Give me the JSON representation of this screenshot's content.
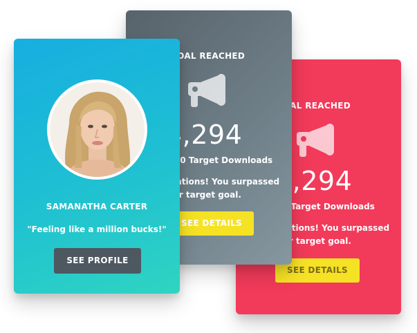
{
  "colors": {
    "red_card": "#f23a5a",
    "gray_card": "#6e7e87",
    "profile_card_gradient_start": "#17aee0",
    "profile_card_gradient_end": "#2fd4c1",
    "yellow_button": "#f6e224",
    "dark_button": "#4e5860"
  },
  "stat_card_front": {
    "label": "GOAL REACHED",
    "icon": "megaphone-icon",
    "number": "4,294",
    "target": "00 Target Downloads",
    "description": "ulations! You surpassed our target goal.",
    "button": "SEE DETAILS"
  },
  "stat_card_back": {
    "label": "OAL REACHED",
    "icon": "megaphone-icon",
    "number": "4,294",
    "target": "0 Target Downloads",
    "description": "ulations! You surpassed our target goal.",
    "button": "SEE DETAILS"
  },
  "profile": {
    "name": "SAMANATHA CARTER",
    "quote": "\"Feeling like a million bucks!\"",
    "button": "SEE PROFILE"
  }
}
